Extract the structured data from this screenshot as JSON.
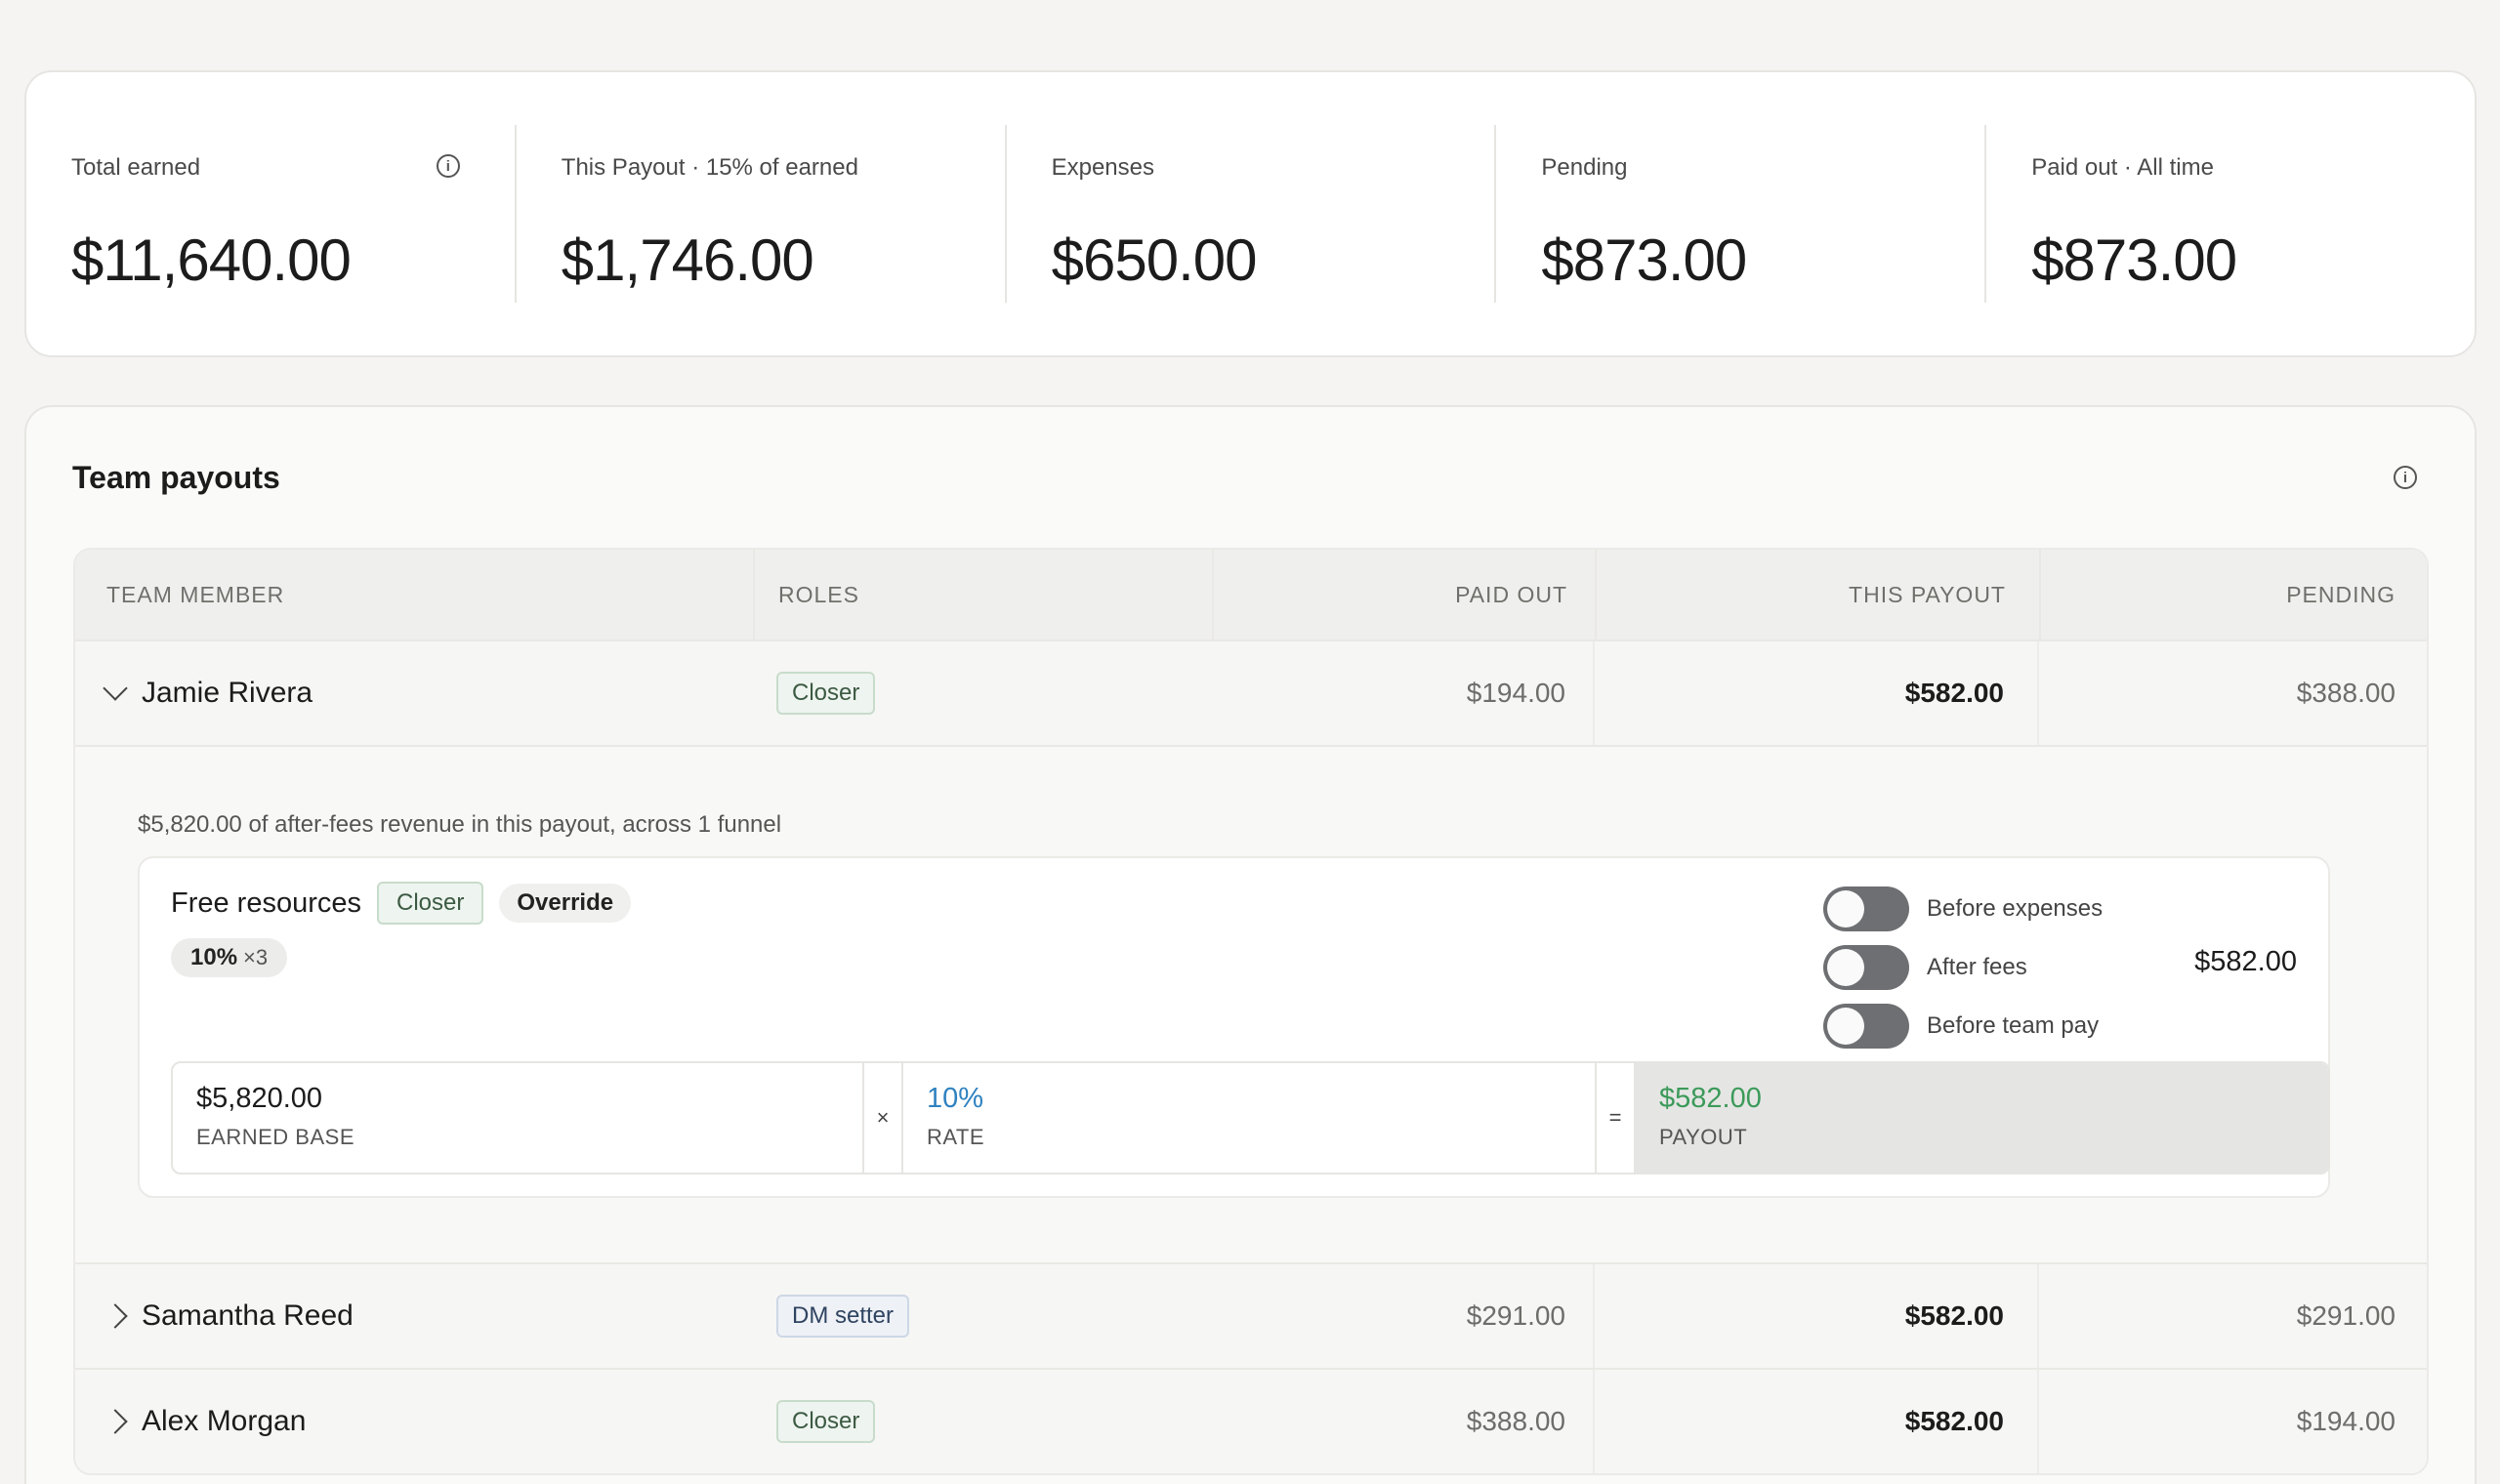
{
  "stats": [
    {
      "label": "Total earned",
      "value": "$11,640.00",
      "info": "i"
    },
    {
      "label": "This Payout · 15% of earned",
      "value": "$1,746.00"
    },
    {
      "label": "Expenses",
      "value": "$650.00"
    },
    {
      "label": "Pending",
      "value": "$873.00"
    },
    {
      "label": "Paid out · All time",
      "value": "$873.00"
    }
  ],
  "team": {
    "title": "Team payouts",
    "info": "i",
    "headers": {
      "member": "TEAM MEMBER",
      "roles": "ROLES",
      "paid_out": "PAID OUT",
      "this_payout": "THIS PAYOUT",
      "pending": "PENDING"
    },
    "rows": [
      {
        "name": "Jamie Rivera",
        "role": "Closer",
        "paid_out": "$194.00",
        "this_payout": "$582.00",
        "pending": "$388.00",
        "expanded": true
      },
      {
        "name": "Samantha Reed",
        "role": "DM setter",
        "paid_out": "$291.00",
        "this_payout": "$582.00",
        "pending": "$291.00"
      },
      {
        "name": "Alex Morgan",
        "role": "Closer",
        "paid_out": "$388.00",
        "this_payout": "$582.00",
        "pending": "$194.00"
      }
    ],
    "detail": {
      "revenue_note": "$5,820.00 of after-fees revenue in this payout, across 1 funnel",
      "rule": {
        "name": "Free resources",
        "role_chip": "Closer",
        "override_chip": "Override",
        "rate_chip": "10%",
        "rate_multiplier": "×3",
        "toggles": [
          {
            "label": "Before expenses",
            "on": false
          },
          {
            "label": "After fees",
            "on": false
          },
          {
            "label": "Before team pay",
            "on": false
          }
        ],
        "total": "$582.00",
        "calc": {
          "base_value": "$5,820.00",
          "base_label": "EARNED BASE",
          "times": "×",
          "rate_value": "10%",
          "rate_label": "RATE",
          "equals": "=",
          "payout_value": "$582.00",
          "payout_label": "PAYOUT"
        }
      }
    }
  },
  "colors": {
    "background": "#f5f4f2",
    "rate_blue": "#2f82c0",
    "payout_green": "#3c9a5a",
    "closer_badge": "#eef4ef",
    "dm_badge": "#eef1f6"
  }
}
